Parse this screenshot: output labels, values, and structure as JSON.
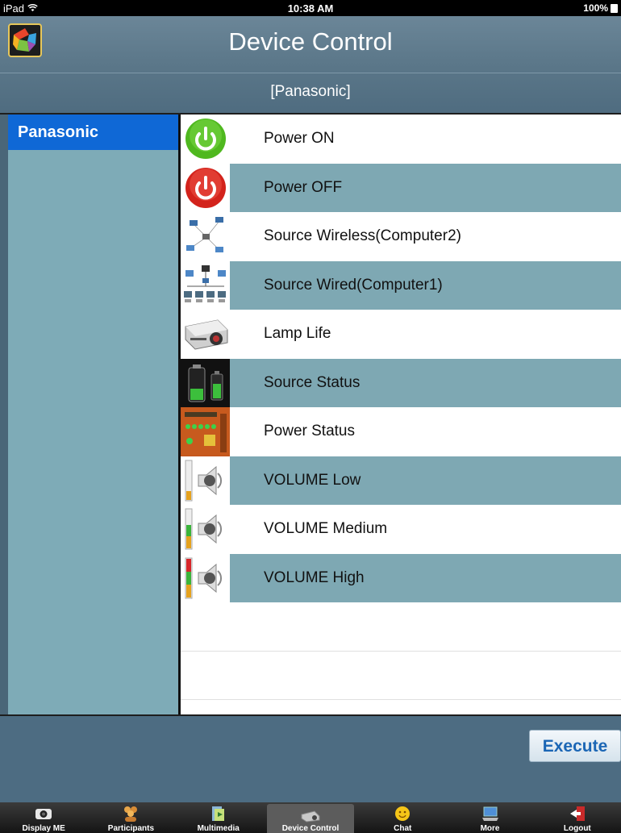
{
  "status_bar": {
    "device": "iPad",
    "time": "10:38 AM",
    "battery": "100%"
  },
  "header": {
    "title": "Device Control",
    "subtitle": "[Panasonic]"
  },
  "sidebar": {
    "items": [
      {
        "label": "Panasonic",
        "selected": true
      }
    ]
  },
  "commands": [
    {
      "label": "Power ON",
      "icon": "power-on-icon"
    },
    {
      "label": "Power OFF",
      "icon": "power-off-icon"
    },
    {
      "label": "Source Wireless(Computer2)",
      "icon": "wireless-network-icon"
    },
    {
      "label": "Source Wired(Computer1)",
      "icon": "wired-network-icon"
    },
    {
      "label": "Lamp Life",
      "icon": "projector-icon"
    },
    {
      "label": "Source Status",
      "icon": "battery-icon"
    },
    {
      "label": "Power Status",
      "icon": "control-panel-icon"
    },
    {
      "label": "VOLUME Low",
      "icon": "volume-low-icon"
    },
    {
      "label": "VOLUME Medium",
      "icon": "volume-medium-icon"
    },
    {
      "label": "VOLUME High",
      "icon": "volume-high-icon"
    }
  ],
  "actions": {
    "execute_label": "Execute"
  },
  "tabbar": {
    "tabs": [
      {
        "label": "Display ME",
        "icon": "camera-icon"
      },
      {
        "label": "Participants",
        "icon": "participants-icon"
      },
      {
        "label": "Multimedia",
        "icon": "multimedia-icon"
      },
      {
        "label": "Device Control",
        "icon": "device-control-icon",
        "active": true
      },
      {
        "label": "Chat",
        "icon": "chat-icon"
      },
      {
        "label": "More",
        "icon": "more-icon"
      },
      {
        "label": "Logout",
        "icon": "logout-icon"
      }
    ]
  },
  "colors": {
    "selected_blue": "#0f68d6",
    "row_alt": "#7ea8b3",
    "header": "#5b7789",
    "execute_text": "#1b66b5"
  }
}
